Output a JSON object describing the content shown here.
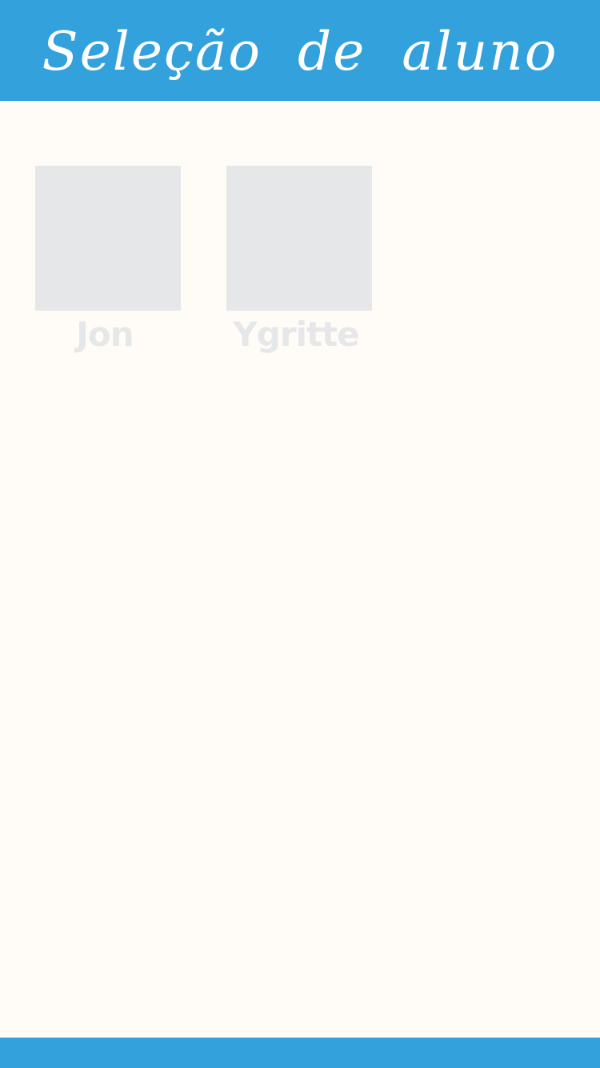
{
  "header": {
    "title": "Seleção de aluno"
  },
  "students": [
    {
      "name": "Jon"
    },
    {
      "name": "Ygritte"
    }
  ],
  "colors": {
    "accent": "#33A1DC",
    "background": "#FFFCF7",
    "placeholder": "#E6E7E9"
  }
}
